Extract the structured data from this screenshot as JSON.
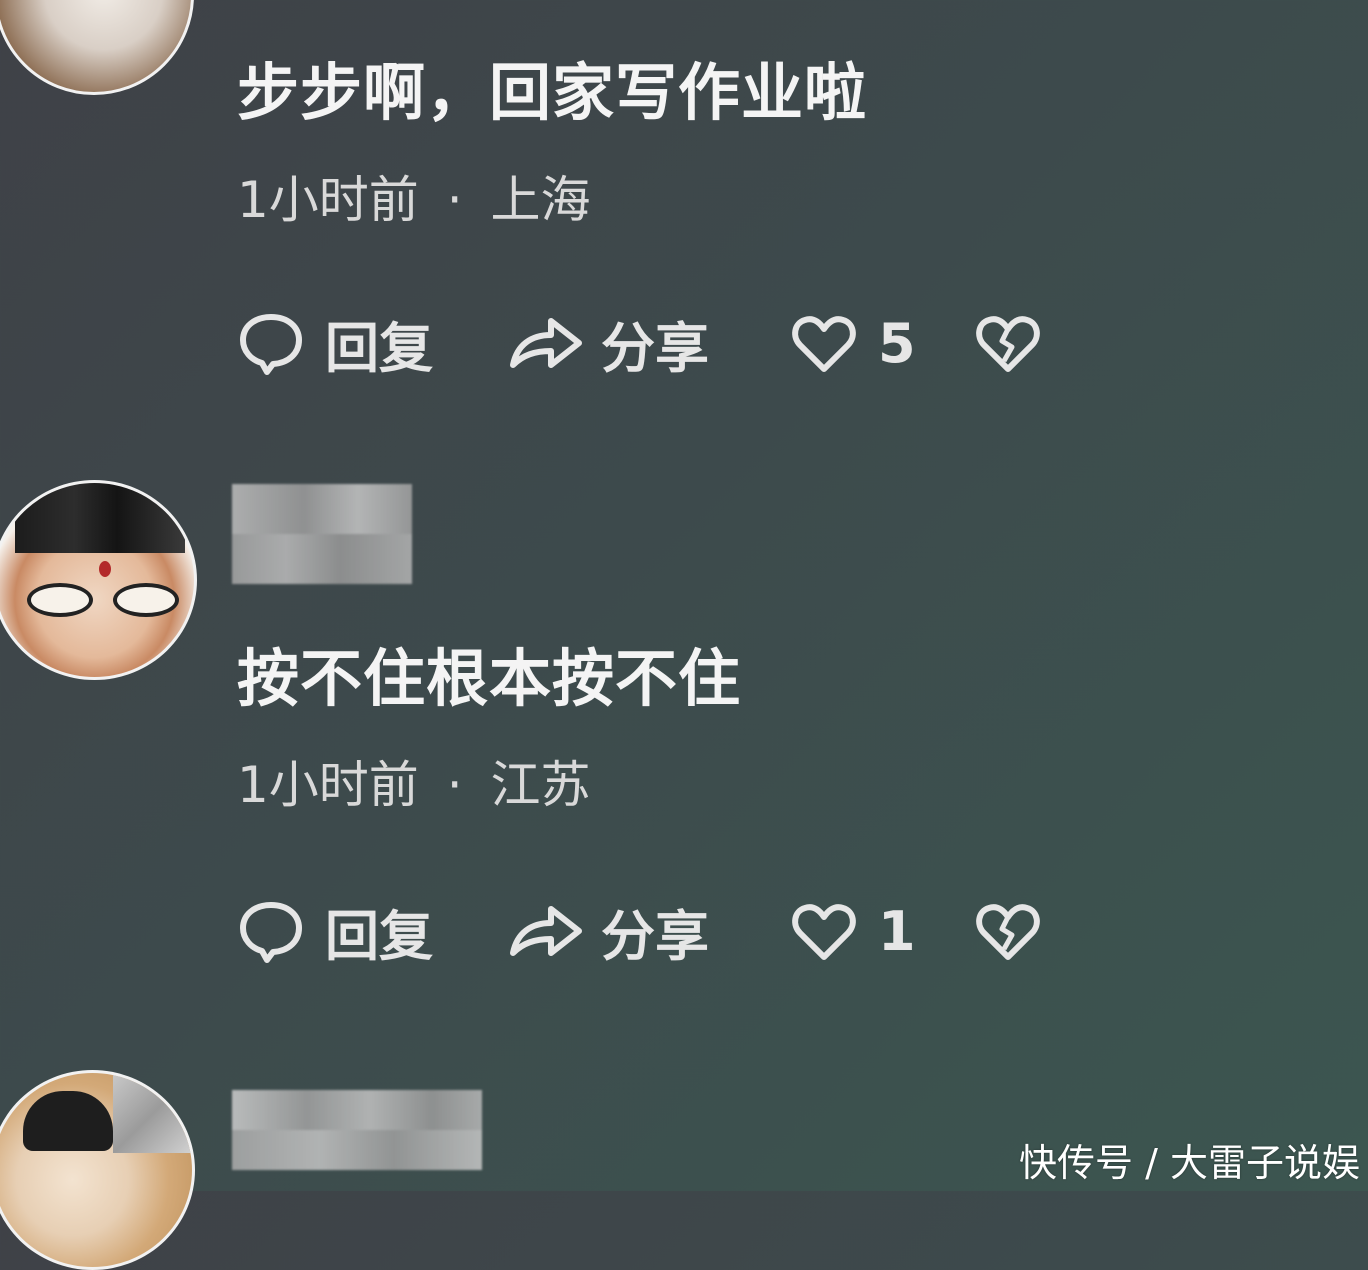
{
  "comments": [
    {
      "text": "步步啊，回家写作业啦",
      "time": "1小时前",
      "separator": "·",
      "location": "上海",
      "reply_label": "回复",
      "share_label": "分享",
      "likes": "5"
    },
    {
      "text": "按不住根本按不住",
      "time": "1小时前",
      "separator": "·",
      "location": "江苏",
      "reply_label": "回复",
      "share_label": "分享",
      "likes": "1"
    }
  ],
  "icons": {
    "reply": "speech-bubble-icon",
    "share": "share-arrow-icon",
    "like": "heart-icon",
    "dislike": "broken-heart-icon"
  },
  "watermark": "快传号 / 大雷子说娱",
  "colors": {
    "text_primary": "#f4f4f4",
    "text_secondary": "#d9d9d9",
    "bg_start": "#3f4147",
    "bg_end": "#3c5650"
  }
}
